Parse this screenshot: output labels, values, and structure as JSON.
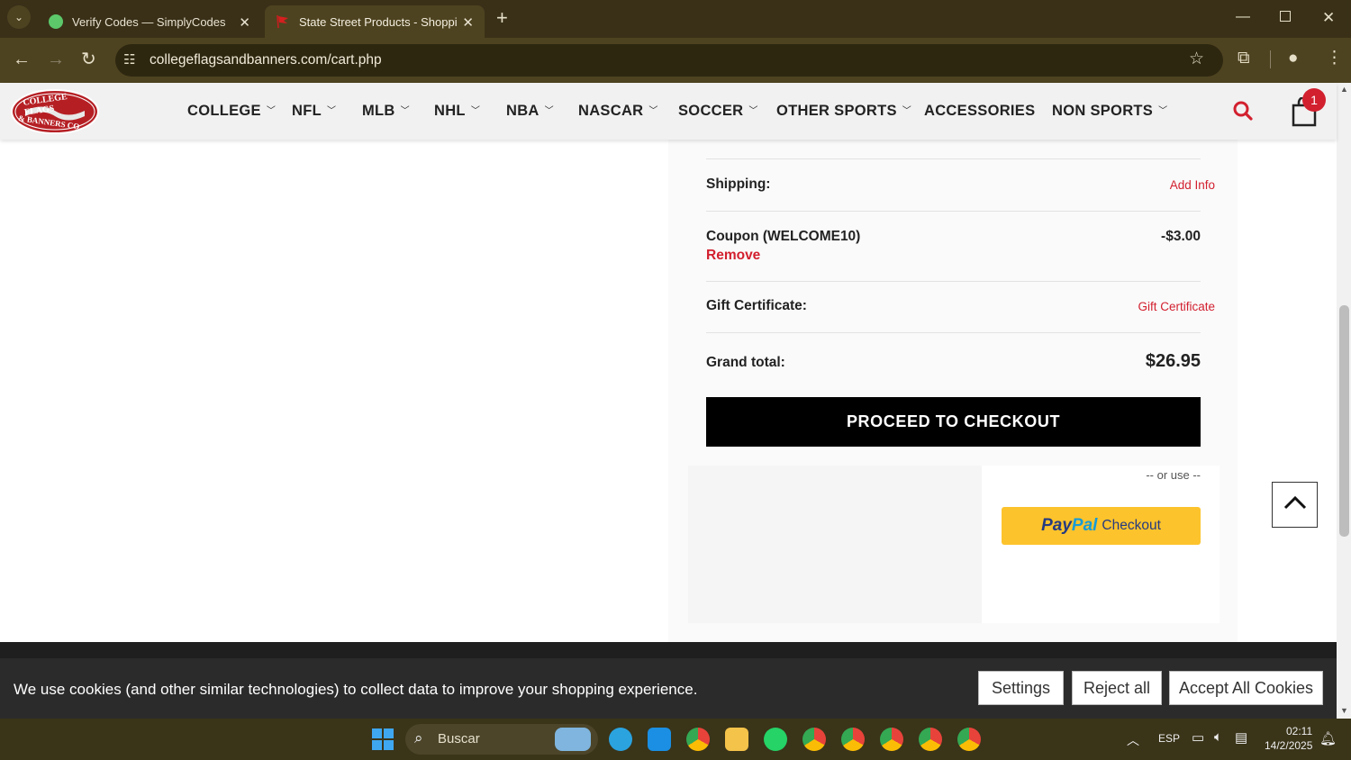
{
  "browser": {
    "tabs": [
      {
        "title": "Verify Codes — SimplyCodes",
        "active": false
      },
      {
        "title": "State Street Products - Shopping C",
        "active": true
      }
    ],
    "url": "collegeflagsandbanners.com/cart.php"
  },
  "site": {
    "logo_text_1": "COLLEGE FLAGS",
    "logo_text_2": "& BANNERS CO.",
    "nav": [
      "COLLEGE",
      "NFL",
      "MLB",
      "NHL",
      "NBA",
      "NASCAR",
      "SOCCER",
      "OTHER SPORTS",
      "ACCESSORIES",
      "NON SPORTS"
    ],
    "cart_count": "1"
  },
  "summary": {
    "shipping_label": "Shipping:",
    "shipping_action": "Add Info",
    "coupon_label": "Coupon (WELCOME10)",
    "coupon_remove": "Remove",
    "coupon_value": "-$3.00",
    "gift_label": "Gift Certificate:",
    "gift_action": "Gift Certificate",
    "grand_total_label": "Grand total:",
    "grand_total_value": "$26.95",
    "checkout_button": "PROCEED TO CHECKOUT",
    "or_use": "-- or use --",
    "paypal_pay": "Pay",
    "paypal_pal": "Pal",
    "paypal_checkout": "Checkout"
  },
  "cookie": {
    "message": "We use cookies (and other similar technologies) to collect data to improve your shopping experience.",
    "settings": "Settings",
    "reject": "Reject all",
    "accept": "Accept All Cookies"
  },
  "taskbar": {
    "search_placeholder": "Buscar",
    "language": "ESP",
    "time": "02:11",
    "date": "14/2/2025"
  },
  "colors": {
    "accent_red": "#d2202f",
    "paypal_yellow": "#fcc32c",
    "checkout_black": "#000000"
  }
}
